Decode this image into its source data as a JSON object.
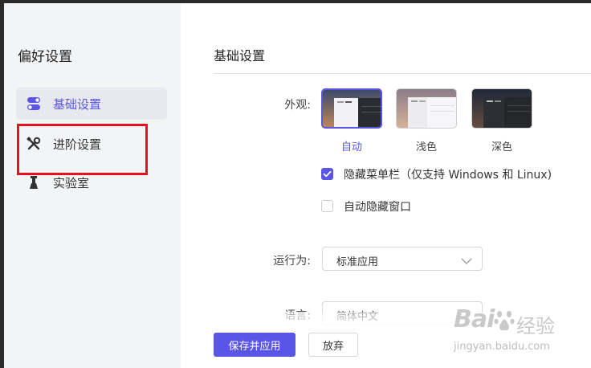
{
  "sidebar": {
    "title": "偏好设置",
    "items": [
      {
        "label": "基础设置",
        "icon": "toggle-icon",
        "active": true
      },
      {
        "label": "进阶设置",
        "icon": "tools-icon",
        "active": false
      },
      {
        "label": "实验室",
        "icon": "flask-icon",
        "active": false
      }
    ]
  },
  "main": {
    "title": "基础设置",
    "appearance": {
      "label": "外观:",
      "options": [
        {
          "name": "自动",
          "selected": true
        },
        {
          "name": "浅色",
          "selected": false
        },
        {
          "name": "深色",
          "selected": false
        }
      ]
    },
    "checkboxes": [
      {
        "label": "隐藏菜单栏（仅支持 Windows 和 Linux)",
        "checked": true
      },
      {
        "label": "自动隐藏窗口",
        "checked": false
      }
    ],
    "run_as": {
      "label": "运行为:",
      "value": "标准应用"
    },
    "language": {
      "label": "语言:",
      "value": "简体中文"
    }
  },
  "footer": {
    "save_label": "保存并应用",
    "discard_label": "放弃"
  },
  "watermark": {
    "brand": "Bai",
    "brand_cn": "经验",
    "url": "jingyan.baidu.com"
  },
  "colors": {
    "accent": "#5b55e6",
    "highlight_box": "#e8101e",
    "sidebar_bg": "#f3f4f6"
  }
}
